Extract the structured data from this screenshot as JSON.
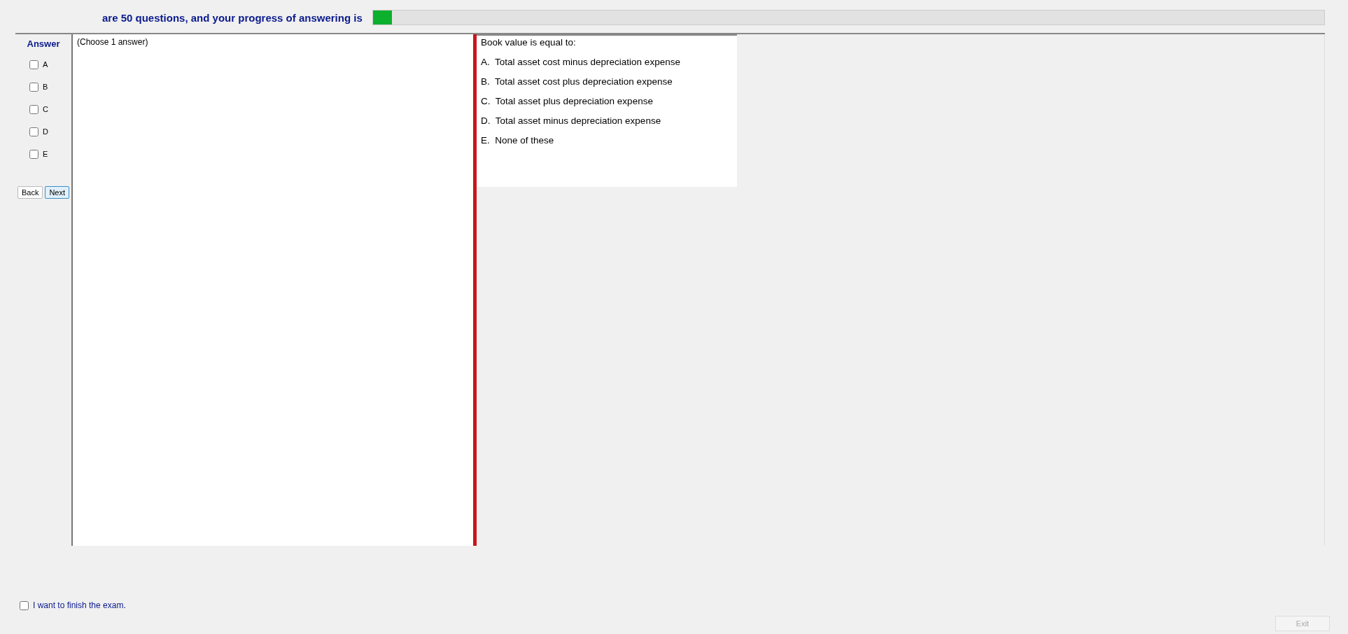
{
  "header": {
    "text": "are 50 questions, and your progress of answering is",
    "progress": {
      "level": 0.02
    }
  },
  "answer_panel": {
    "title": "Answer",
    "options": [
      {
        "label": "A",
        "checked": false
      },
      {
        "label": "B",
        "checked": false
      },
      {
        "label": "C",
        "checked": false
      },
      {
        "label": "D",
        "checked": false
      },
      {
        "label": "E",
        "checked": false
      }
    ],
    "buttons": [
      {
        "label": "Back",
        "selected": false
      },
      {
        "label": "Next",
        "selected": true
      }
    ]
  },
  "instruction": "(Choose 1 answer)",
  "question": {
    "text": "Book value is equal to:",
    "choices": [
      "A.  Total asset cost minus depreciation expense",
      "B.  Total asset cost plus depreciation expense",
      "C.  Total asset plus depreciation expense",
      "D.  Total asset minus depreciation expense",
      "E.  None of these"
    ]
  },
  "finish": {
    "label": "I want to finish the exam.",
    "checked": false
  },
  "exit_button": {
    "label": "Exit",
    "disabled": true
  }
}
